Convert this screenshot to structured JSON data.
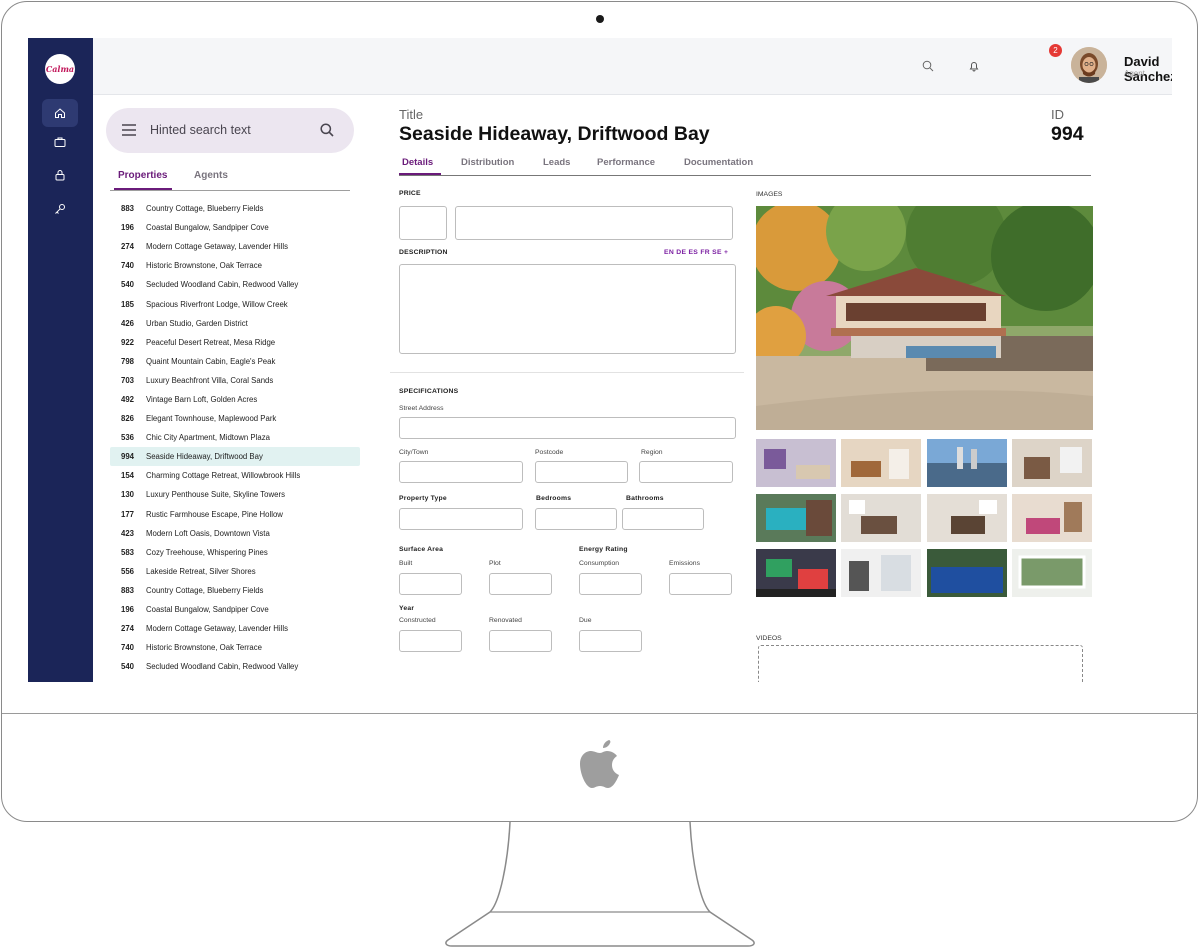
{
  "user": {
    "name": "David Sanchez",
    "role": "Agent",
    "notifications": "2"
  },
  "app": {
    "logo_text": "Calma"
  },
  "search": {
    "placeholder": "Hinted search text"
  },
  "list_tabs": [
    "Properties",
    "Agents"
  ],
  "properties": [
    {
      "id": "883",
      "name": "Country Cottage, Blueberry Fields"
    },
    {
      "id": "196",
      "name": "Coastal Bungalow, Sandpiper Cove"
    },
    {
      "id": "274",
      "name": "Modern Cottage Getaway, Lavender Hills"
    },
    {
      "id": "740",
      "name": "Historic Brownstone, Oak Terrace"
    },
    {
      "id": "540",
      "name": "Secluded Woodland Cabin, Redwood Valley"
    },
    {
      "id": "185",
      "name": "Spacious Riverfront Lodge, Willow Creek"
    },
    {
      "id": "426",
      "name": "Urban Studio, Garden District"
    },
    {
      "id": "922",
      "name": "Peaceful Desert Retreat, Mesa Ridge"
    },
    {
      "id": "798",
      "name": "Quaint Mountain Cabin, Eagle's Peak"
    },
    {
      "id": "703",
      "name": "Luxury Beachfront Villa, Coral Sands"
    },
    {
      "id": "492",
      "name": "Vintage Barn Loft, Golden Acres"
    },
    {
      "id": "826",
      "name": "Elegant Townhouse, Maplewood Park"
    },
    {
      "id": "536",
      "name": "Chic City Apartment, Midtown Plaza"
    },
    {
      "id": "994",
      "name": "Seaside Hideaway, Driftwood Bay",
      "selected": true
    },
    {
      "id": "154",
      "name": "Charming Cottage Retreat, Willowbrook Hills"
    },
    {
      "id": "130",
      "name": "Luxury Penthouse Suite, Skyline Towers"
    },
    {
      "id": "177",
      "name": "Rustic Farmhouse Escape, Pine Hollow"
    },
    {
      "id": "423",
      "name": "Modern Loft Oasis, Downtown Vista"
    },
    {
      "id": "583",
      "name": "Cozy Treehouse, Whispering Pines"
    },
    {
      "id": "556",
      "name": "Lakeside Retreat, Silver Shores"
    },
    {
      "id": "883",
      "name": "Country Cottage, Blueberry Fields"
    },
    {
      "id": "196",
      "name": "Coastal Bungalow, Sandpiper Cove"
    },
    {
      "id": "274",
      "name": "Modern Cottage Getaway, Lavender Hills"
    },
    {
      "id": "740",
      "name": "Historic Brownstone, Oak Terrace"
    },
    {
      "id": "540",
      "name": "Secluded Woodland Cabin, Redwood Valley"
    }
  ],
  "detail": {
    "title_label": "Title",
    "title": "Seaside Hideaway, Driftwood Bay",
    "id_label": "ID",
    "id": "994",
    "tabs": [
      "Details",
      "Distribution",
      "Leads",
      "Performance",
      "Documentation"
    ],
    "price_label": "PRICE",
    "description_label": "DESCRIPTION",
    "languages": "EN DE ES FR SE +",
    "specifications_label": "SPECIFICATIONS",
    "street_address": "Street Address",
    "city": "City/Town",
    "postcode": "Postcode",
    "region": "Region",
    "property_type": "Property Type",
    "bedrooms": "Bedrooms",
    "bathrooms": "Bathrooms",
    "surface_area": "Surface Area",
    "built": "Built",
    "plot": "Plot",
    "energy_rating": "Energy Rating",
    "consumption": "Consumption",
    "emissions": "Emissions",
    "year": "Year",
    "constructed": "Constructed",
    "renovated": "Renovated",
    "due": "Due",
    "images_label": "IMAGES",
    "videos_label": "VIDEOS"
  },
  "colors": {
    "rail": "#1b2558",
    "accent": "#6a1b7a",
    "selected_row": "#e1f2f1"
  }
}
